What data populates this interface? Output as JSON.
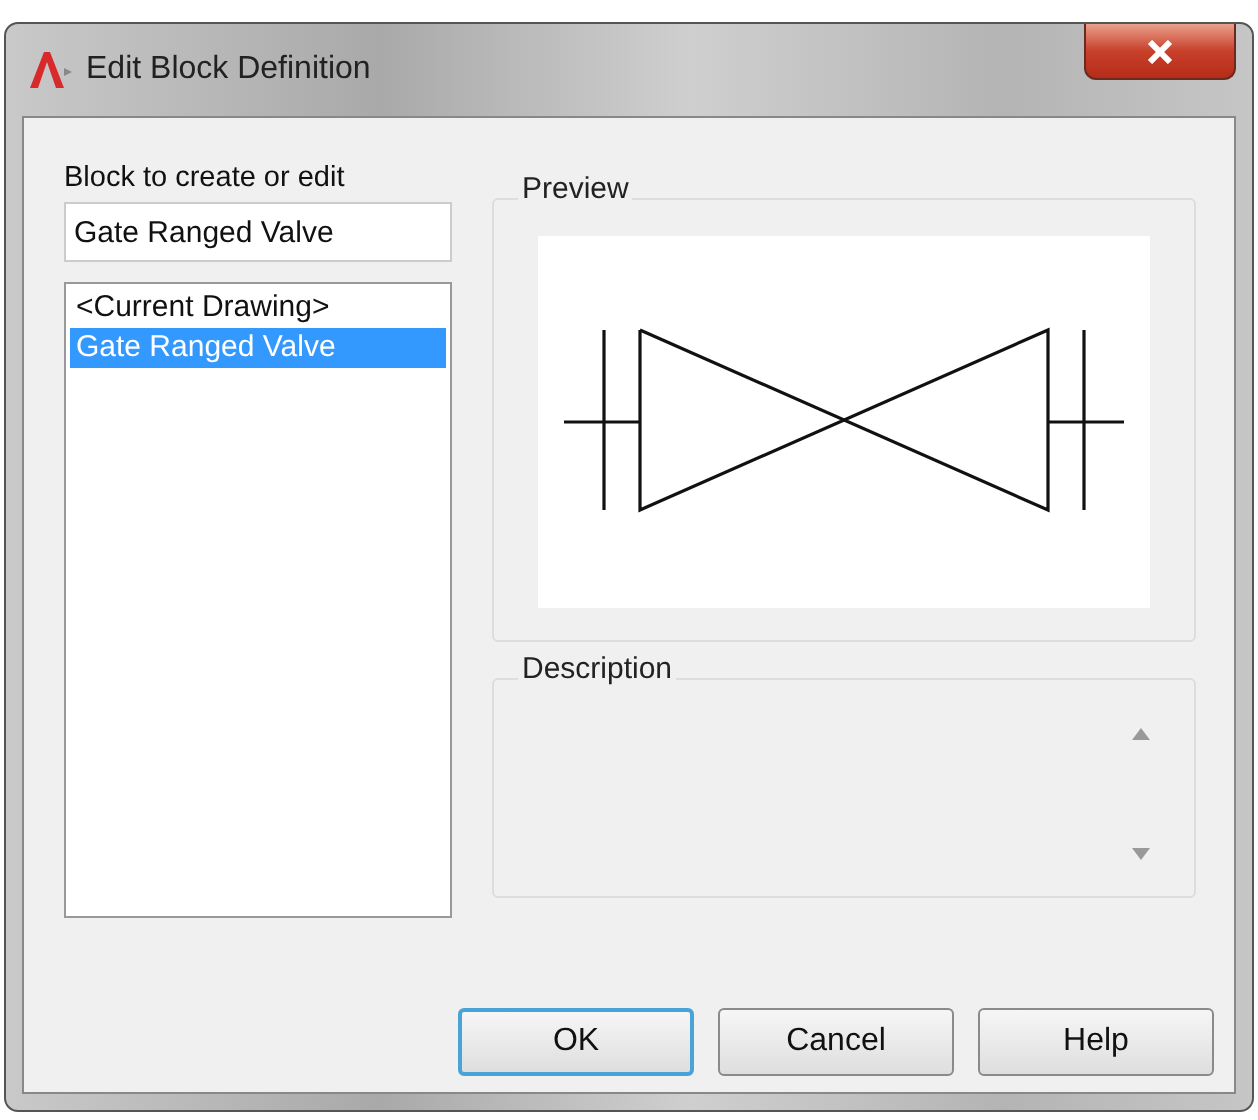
{
  "window": {
    "title": "Edit Block Definition"
  },
  "block_field": {
    "label": "Block to create or edit",
    "value": "Gate Ranged Valve"
  },
  "block_list": [
    {
      "label": "<Current Drawing>",
      "selected": false
    },
    {
      "label": "Gate Ranged Valve",
      "selected": true
    }
  ],
  "preview": {
    "title": "Preview"
  },
  "description": {
    "title": "Description"
  },
  "buttons": [
    {
      "label": "OK",
      "default": true
    },
    {
      "label": "Cancel",
      "default": false
    },
    {
      "label": "Help",
      "default": false
    }
  ]
}
